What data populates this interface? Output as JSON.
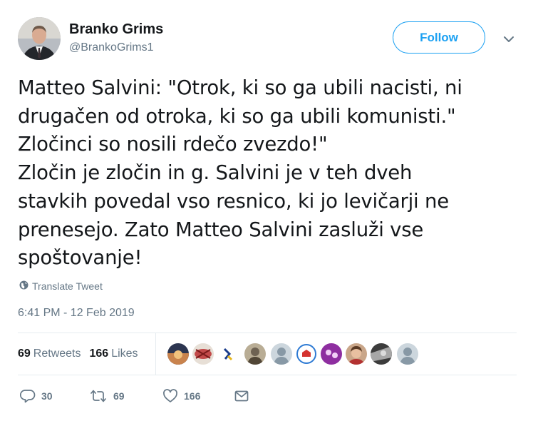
{
  "author": {
    "name": "Branko Grims",
    "handle": "@BrankoGrims1"
  },
  "follow_label": "Follow",
  "tweet": {
    "lines": [
      "Matteo Salvini: \"Otrok, ki so ga ubili nacisti, ni",
      "drugačen od otroka, ki so ga ubili komunisti.\"",
      "Zločinci so nosili rdečo zvezdo!\"",
      "Zločin je zločin in g. Salvini je v teh dveh",
      "stavkih povedal vso resnico, ki jo levičarji ne",
      "prenesejo. Zato Matteo Salvini zasluži vse",
      "spoštovanje!"
    ]
  },
  "translate_label": "Translate Tweet",
  "timestamp": "6:41 PM - 12 Feb 2019",
  "stats": {
    "retweets_count": "69",
    "retweets_label": "Retweets",
    "likes_count": "166",
    "likes_label": "Likes"
  },
  "actions": {
    "reply_count": "30",
    "retweet_count": "69",
    "like_count": "166"
  },
  "colors": {
    "accent": "#1da1f2",
    "muted": "#657786",
    "divider": "#e6ecf0"
  },
  "icons": [
    "caret-down-icon",
    "globe-icon",
    "reply-icon",
    "retweet-icon",
    "heart-icon",
    "message-icon"
  ]
}
